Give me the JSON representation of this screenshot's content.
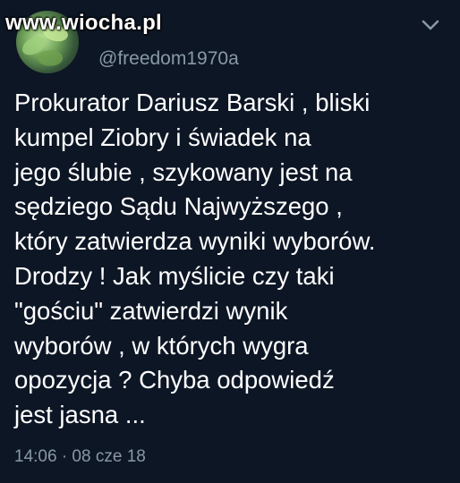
{
  "watermark": "www.wiocha.pl",
  "author": {
    "display_name": "",
    "handle": "@freedom1970a",
    "avatar_icon": "avatar-plant-icon"
  },
  "menu_icon": "chevron-down-icon",
  "tweet": {
    "text": "Prokurator Dariusz Barski , bliski\nkumpel Ziobry i świadek na\njego ślubie , szykowany jest na\nsędziego Sądu Najwyższego ,\nktóry zatwierdza wyniki wyborów.\nDrodzy ! Jak myślicie czy taki\n\"gościu\" zatwierdzi wynik\nwyborów , w których wygra\nopozycja ? Chyba odpowiedź\njest jasna ...",
    "timestamp": "14:06 · 08 cze 18"
  },
  "colors": {
    "background": "#0d1625",
    "text": "#ffffff",
    "secondary": "#8899a6"
  }
}
